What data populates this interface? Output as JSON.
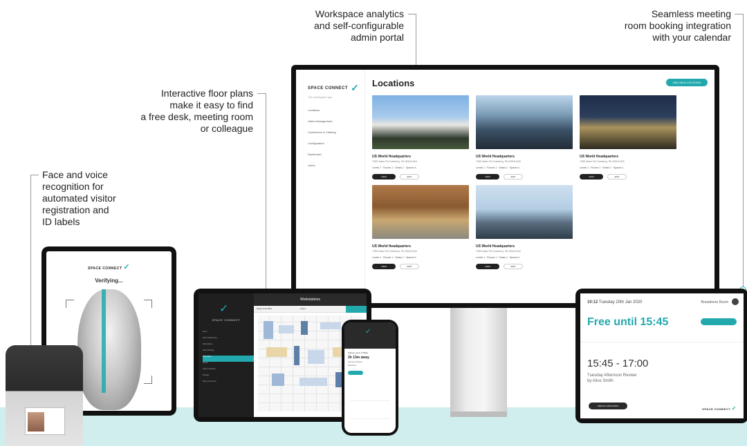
{
  "callouts": {
    "analytics": [
      "Workspace analytics",
      "and self-configurable",
      "admin portal"
    ],
    "booking": [
      "Seamless meeting",
      "room booking integration",
      "with your calendar"
    ],
    "floorplans": [
      "Interactive floor plans",
      "make it easy to find",
      "a free desk, meeting room",
      "or colleague"
    ],
    "face": [
      "Face and voice",
      "recognition for",
      "automated visitor",
      "registration and",
      "ID labels"
    ]
  },
  "monitor": {
    "brand": "SPACE CONNECT",
    "brand_sub": "The workspace app",
    "nav": [
      "Locations",
      "Visitor Management",
      "Conference & Catering",
      "Configuration",
      "Dashboard",
      "Users"
    ],
    "page_title": "Locations",
    "add_button": "ADD NEW LOCATION",
    "cards": [
      {
        "name": "US World Headquarters",
        "address": "7355 Galen Rd Cranberry, PA 15018 USA",
        "stats": "Levels 7 · Rooms 1 · Desks 1 · Spaces 4",
        "view": "VIEW",
        "edit": "EDIT"
      },
      {
        "name": "US World Headquarters",
        "address": "7355 Galen Rd Cranberry, PA 15018 USA",
        "stats": "Levels 1 · Rooms 1 · Desks 1 · Spaces 1",
        "view": "VIEW",
        "edit": "EDIT"
      },
      {
        "name": "US World Headquarters",
        "address": "7355 Galen Rd Cranberry, PA 15018 USA",
        "stats": "Levels 1 · Rooms 1 · Desks 1 · Spaces 1",
        "view": "VIEW",
        "edit": "EDIT"
      },
      {
        "name": "US World Headquarters",
        "address": "7355 Galen Rd Cranberry, PA 15018 USA",
        "stats": "Levels 1 · Rooms 1 · Desks 1 · Spaces 4",
        "view": "VIEW",
        "edit": "EDIT"
      },
      {
        "name": "US World Headquarters",
        "address": "7355 Galen Rd Cranberry, PA 15018 USA",
        "stats": "Levels 1 · Rooms 1 · Desks 1 · Spaces 1",
        "view": "VIEW",
        "edit": "EDIT"
      }
    ]
  },
  "verify": {
    "brand": "SPACE CONNECT",
    "status": "Verifying..."
  },
  "workstations": {
    "brand": "SPACE CONNECT",
    "title": "Workstations",
    "filter_left": "Sydney Level Office",
    "filter_right": "Level 3",
    "nav": [
      "Home",
      "Visitor Registration",
      "Workstations",
      "Room Booking",
      "Floor plans",
      "Rooms",
      "Visitor Invitations",
      "Settings",
      "Sign out of Floors"
    ]
  },
  "phone": {
    "location": "Sydney Level 3 Office",
    "time": "2h 13m away",
    "line1": "Afternoon Meeting",
    "line2": "Boardroom"
  },
  "room": {
    "time": "10:12",
    "date": "Tuesday 20th Jan 2020",
    "room_name": "Broadmore Room",
    "free": "Free until 15:45",
    "next_time": "15:45 - 17:00",
    "next_event": "Tuesday Afternoon Review",
    "next_by": "by Alice Smith",
    "bottom_button": "VIEW ALL BOOKINGS",
    "brand": "SPACE CONNECT"
  }
}
